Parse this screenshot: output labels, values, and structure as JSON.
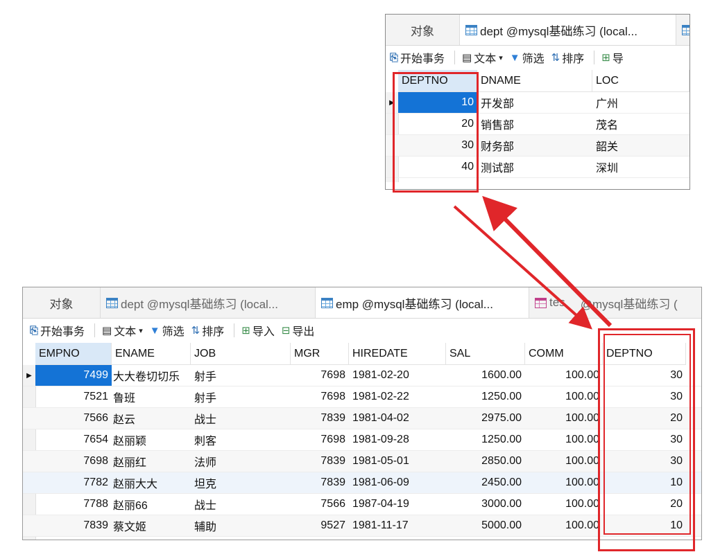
{
  "dept_window": {
    "tabs": [
      {
        "label": "对象"
      },
      {
        "label": "dept @mysql基础练习 (local..."
      }
    ],
    "toolbar": {
      "begin_tx": "开始事务",
      "text": "文本",
      "text_arrow": "▾",
      "filter": "筛选",
      "sort": "排序",
      "import_partial": "导"
    },
    "columns": [
      "DEPTNO",
      "DNAME",
      "LOC"
    ],
    "rows": [
      {
        "deptno": "10",
        "dname": "开发部",
        "loc": "广州"
      },
      {
        "deptno": "20",
        "dname": "销售部",
        "loc": "茂名"
      },
      {
        "deptno": "30",
        "dname": "财务部",
        "loc": "韶关"
      },
      {
        "deptno": "40",
        "dname": "测试部",
        "loc": "深圳"
      }
    ]
  },
  "emp_window": {
    "tabs": [
      {
        "label": "对象"
      },
      {
        "label": "dept @mysql基础练习 (local..."
      },
      {
        "label": "emp @mysql基础练习 (local..."
      },
      {
        "label": "tes",
        "label_b": "@mysql基础练习 ("
      }
    ],
    "toolbar": {
      "begin_tx": "开始事务",
      "text": "文本",
      "text_arrow": "▾",
      "filter": "筛选",
      "sort": "排序",
      "import": "导入",
      "export": "导出"
    },
    "columns": [
      "EMPNO",
      "ENAME",
      "JOB",
      "MGR",
      "HIREDATE",
      "SAL",
      "COMM",
      "DEPTNO"
    ],
    "rows": [
      {
        "empno": "7499",
        "ename": "大大卷切切乐",
        "job": "射手",
        "mgr": "7698",
        "hiredate": "1981-02-20",
        "sal": "1600.00",
        "comm": "100.00",
        "deptno": "30"
      },
      {
        "empno": "7521",
        "ename": "鲁班",
        "job": "射手",
        "mgr": "7698",
        "hiredate": "1981-02-22",
        "sal": "1250.00",
        "comm": "100.00",
        "deptno": "30"
      },
      {
        "empno": "7566",
        "ename": "赵云",
        "job": "战士",
        "mgr": "7839",
        "hiredate": "1981-04-02",
        "sal": "2975.00",
        "comm": "100.00",
        "deptno": "20"
      },
      {
        "empno": "7654",
        "ename": "赵丽颖",
        "job": "刺客",
        "mgr": "7698",
        "hiredate": "1981-09-28",
        "sal": "1250.00",
        "comm": "100.00",
        "deptno": "30"
      },
      {
        "empno": "7698",
        "ename": "赵丽红",
        "job": "法师",
        "mgr": "7839",
        "hiredate": "1981-05-01",
        "sal": "2850.00",
        "comm": "100.00",
        "deptno": "30"
      },
      {
        "empno": "7782",
        "ename": "赵丽大大",
        "job": "坦克",
        "mgr": "7839",
        "hiredate": "1981-06-09",
        "sal": "2450.00",
        "comm": "100.00",
        "deptno": "10"
      },
      {
        "empno": "7788",
        "ename": "赵丽66",
        "job": "战士",
        "mgr": "7566",
        "hiredate": "1987-04-19",
        "sal": "3000.00",
        "comm": "100.00",
        "deptno": "20"
      },
      {
        "empno": "7839",
        "ename": "蔡文姬",
        "job": "辅助",
        "mgr": "9527",
        "hiredate": "1981-11-17",
        "sal": "5000.00",
        "comm": "100.00",
        "deptno": "10"
      }
    ]
  },
  "row_indicator": "▶",
  "icons": {
    "table": "table-icon",
    "query": "query-table-icon",
    "transaction": "begin-transaction-icon",
    "text": "text-view-icon",
    "filter": "filter-icon",
    "sort": "sort-icon",
    "import": "import-icon",
    "export": "export-icon",
    "row_pointer": "row-pointer-icon"
  },
  "colors": {
    "annotation_red": "#e0262a",
    "selection_blue": "#1473d6",
    "header_selected": "#d9e8f7"
  }
}
